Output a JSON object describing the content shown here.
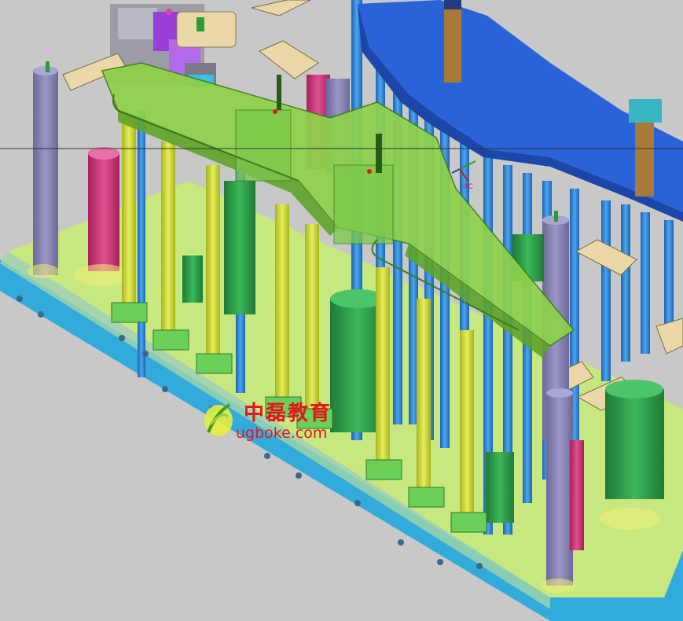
{
  "scene": {
    "background": "#c8c8c8",
    "colors": {
      "base_top": "#c8ec78",
      "base_side": "#34aee0",
      "fixture_green": "#8ed24a",
      "fixture_dark": "#5fa32a",
      "support_yellow": "#d6e040",
      "rod_blue": "#2f86d8",
      "panel_blue": "#2a62d8",
      "cylinder_green": "#2fa14a",
      "post_purple": "#8a86b8",
      "post_magenta": "#d0307e",
      "clamp_purple": "#9a3ed8",
      "tan_pad": "#ead8a8",
      "brown_pin": "#a87a3a"
    }
  },
  "triad": {
    "label": "XC"
  },
  "watermark": {
    "chinese_text": "中磊教育",
    "url_text": "ugboke.com",
    "color": "#e8141c"
  }
}
